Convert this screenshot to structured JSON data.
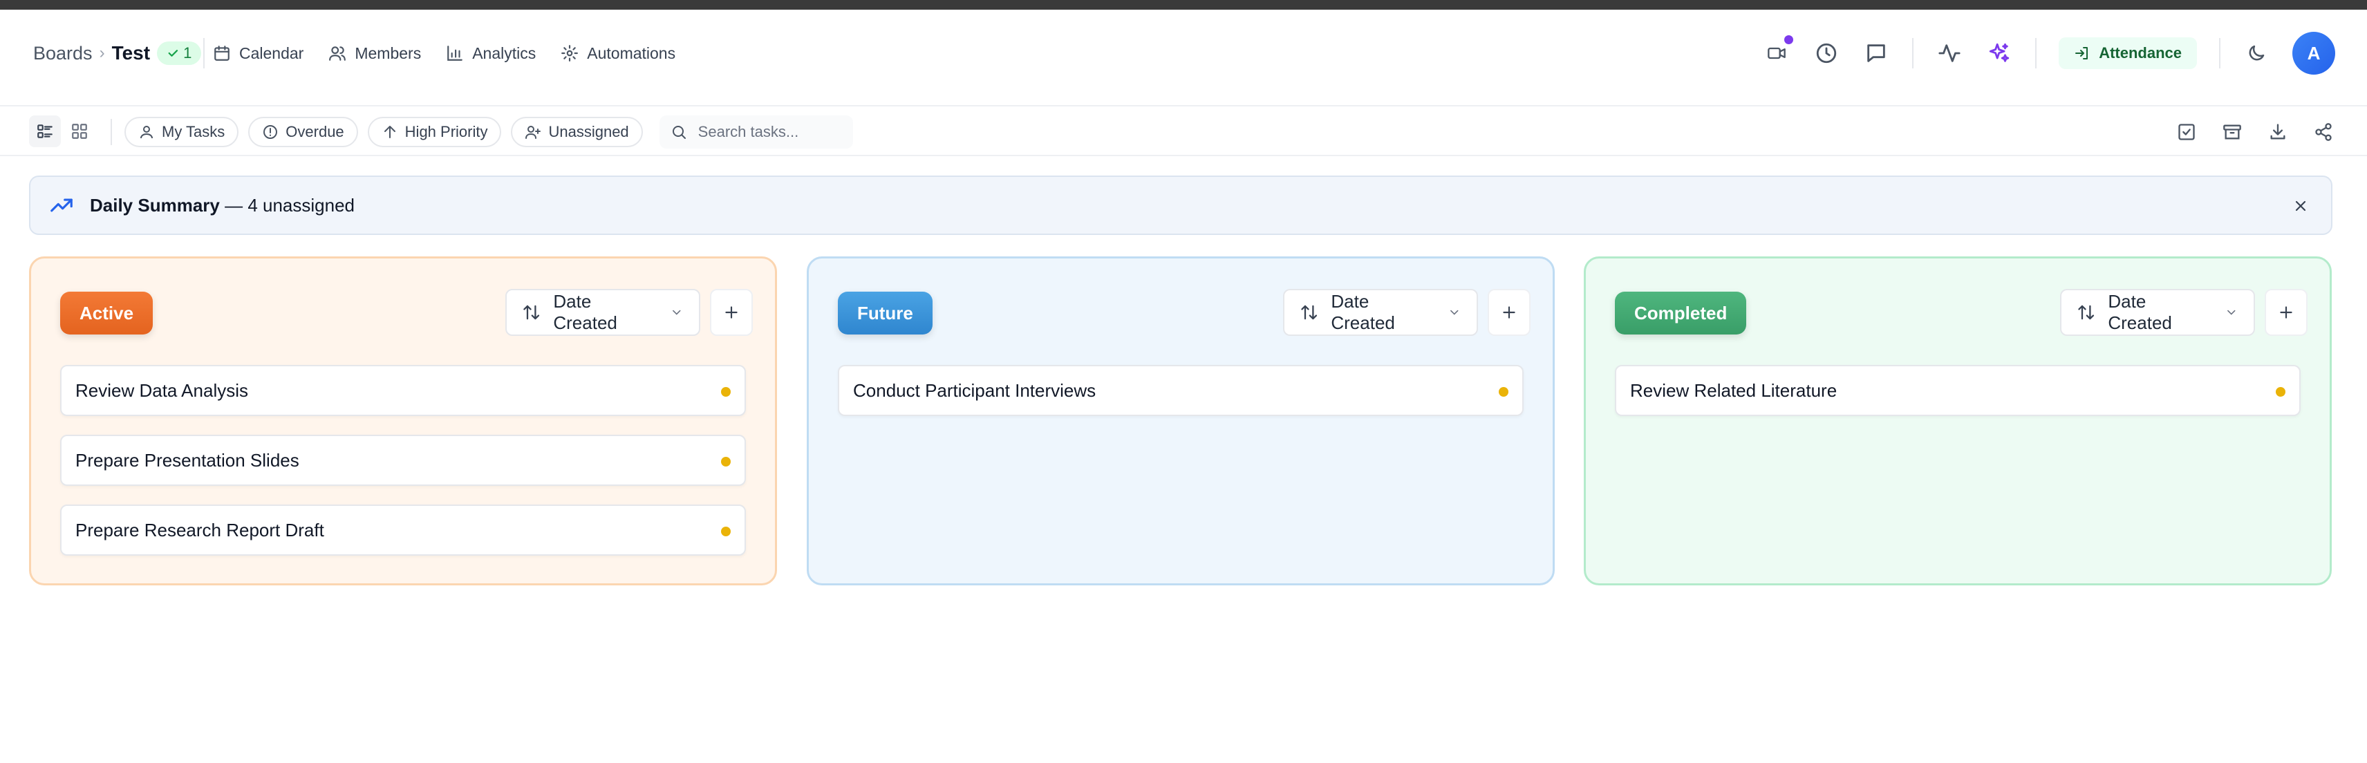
{
  "breadcrumb": {
    "root": "Boards",
    "separator": "›",
    "current": "Test",
    "badge_count": "1"
  },
  "nav": [
    {
      "label": "Calendar",
      "icon": "calendar-icon"
    },
    {
      "label": "Members",
      "icon": "members-icon"
    },
    {
      "label": "Analytics",
      "icon": "analytics-icon"
    },
    {
      "label": "Automations",
      "icon": "gear-icon"
    }
  ],
  "header_right": {
    "attendance_label": "Attendance",
    "avatar_initial": "A",
    "icons": [
      "video-icon",
      "clock-icon",
      "chat-icon",
      "activity-icon",
      "sparkles-icon",
      "moon-icon"
    ]
  },
  "toolbar": {
    "filters": [
      "My Tasks",
      "Overdue",
      "High Priority",
      "Unassigned"
    ],
    "search_placeholder": "Search tasks...",
    "right_icons": [
      "checkbox-icon",
      "archive-icon",
      "download-icon",
      "share-icon"
    ]
  },
  "summary": {
    "title": "Daily Summary",
    "text": "— 4 unassigned"
  },
  "columns": [
    {
      "status": "Active",
      "sort_label": "Date Created",
      "tasks": [
        "Review Data Analysis",
        "Prepare Presentation Slides",
        "Prepare Research Report Draft"
      ]
    },
    {
      "status": "Future",
      "sort_label": "Date Created",
      "tasks": [
        "Conduct Participant Interviews"
      ]
    },
    {
      "status": "Completed",
      "sort_label": "Date Created",
      "tasks": [
        "Review Related Literature"
      ]
    }
  ],
  "colors": {
    "active": "#e96b27",
    "future": "#3a94d9",
    "completed": "#43a972",
    "priority_dot": "#eab308",
    "notification_dot": "#7c3aed",
    "avatar": "#2563eb"
  }
}
